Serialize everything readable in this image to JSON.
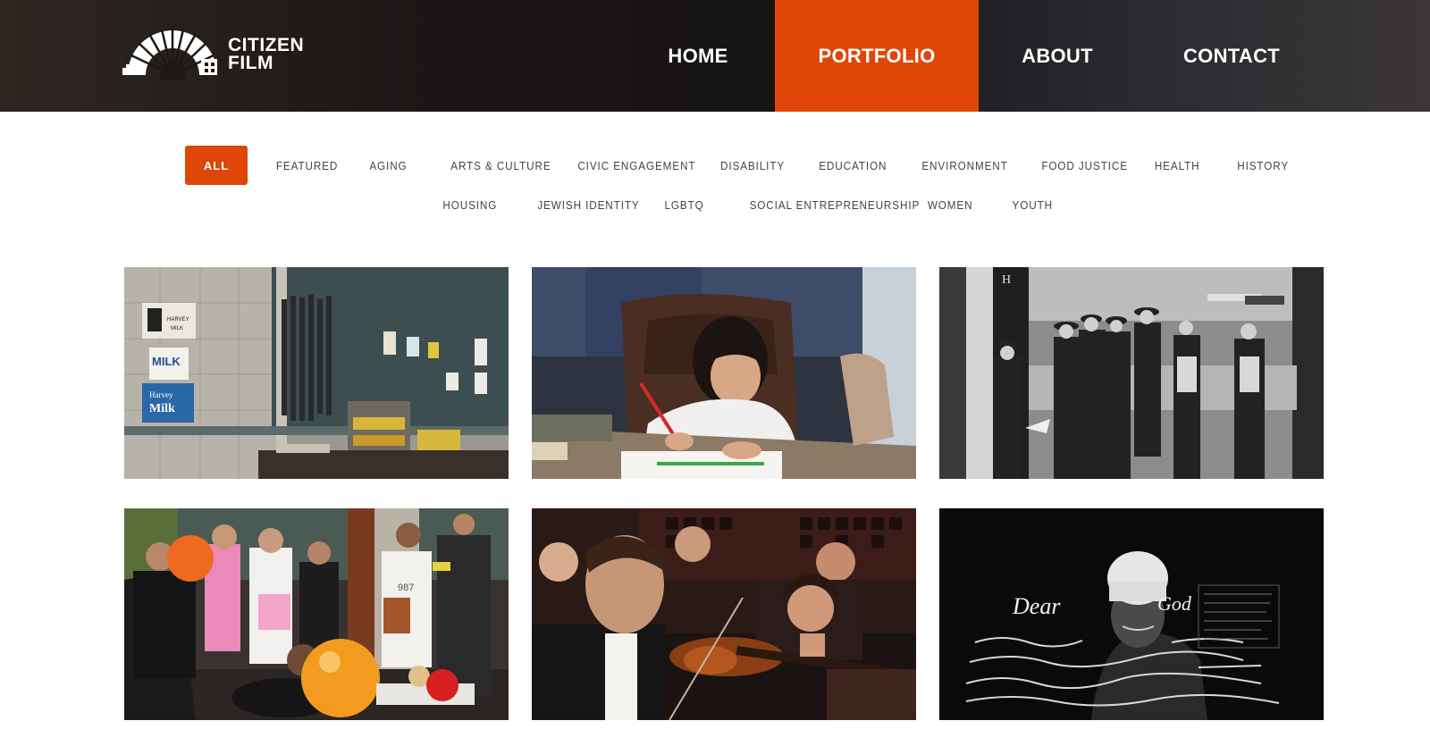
{
  "brand": {
    "line1": "CITIZEN",
    "line2": "FILM"
  },
  "nav": [
    {
      "label": "HOME",
      "active": false
    },
    {
      "label": "PORTFOLIO",
      "active": true
    },
    {
      "label": "ABOUT",
      "active": false
    },
    {
      "label": "CONTACT",
      "active": false
    }
  ],
  "filters": {
    "row1": [
      "ALL",
      "FEATURED",
      "AGING",
      "ARTS & CULTURE",
      "CIVIC ENGAGEMENT",
      "DISABILITY",
      "EDUCATION",
      "ENVIRONMENT",
      "FOOD JUSTICE",
      "HEALTH",
      "HISTORY"
    ],
    "row2": [
      "HOUSING",
      "JEWISH IDENTITY",
      "LGBTQ",
      "SOCIAL ENTREPRENEURSHIP",
      "WOMEN",
      "YOUTH"
    ],
    "selected": "ALL"
  },
  "tiles": {
    "t1": {
      "milk": "MILK",
      "harvey": "Harvey",
      "milk2": "Milk",
      "harvey_small": "HARVEY",
      "milk_small": "MILK"
    },
    "t3": {
      "sign": "H"
    },
    "t4": {
      "shirt": "987"
    },
    "t6": {
      "script1": "Dear",
      "script2": "God"
    }
  },
  "colors": {
    "accent": "#df4607",
    "header_bg": "#1b1716"
  }
}
